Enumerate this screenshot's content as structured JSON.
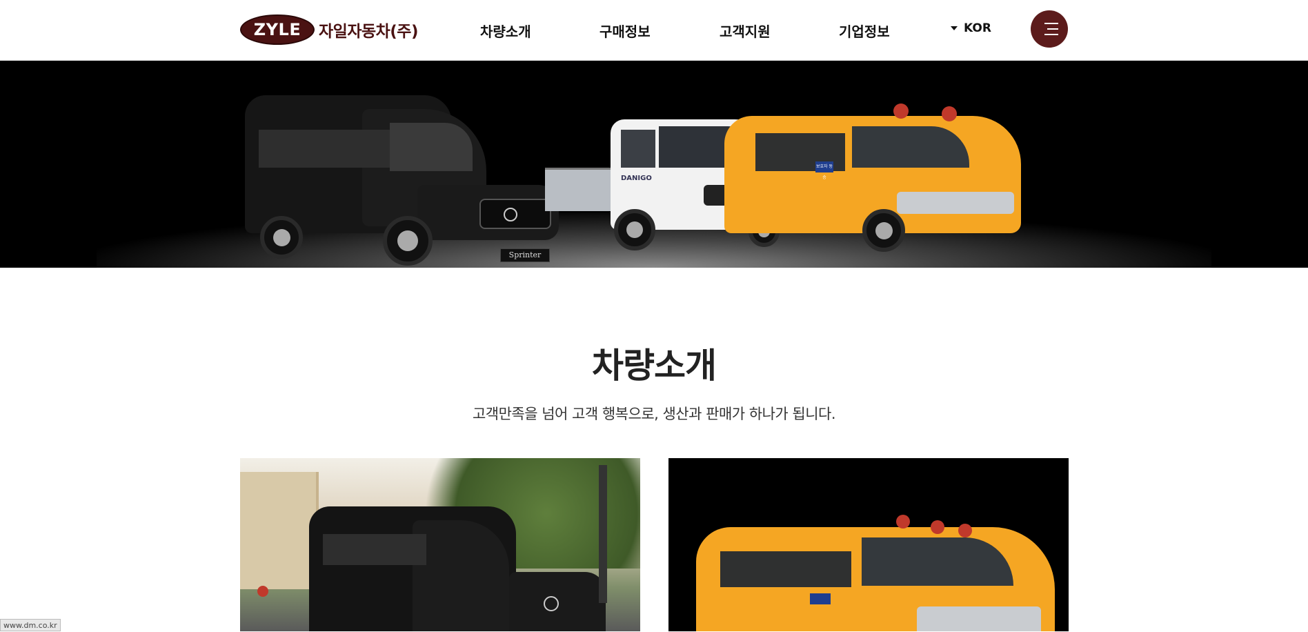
{
  "header": {
    "logo_mark": "ZYLE",
    "logo_text": "자일자동차(주)",
    "nav": [
      "차량소개",
      "구매정보",
      "고객지원",
      "기업정보"
    ],
    "lang": "KOR"
  },
  "hero": {
    "van_badge": "Sprinter",
    "truck_badge": "DANIGO",
    "bus_sign": "보호자 동승"
  },
  "section": {
    "title": "차량소개",
    "subtitle": "고객만족을 넘어 고객 행복으로, 생산과 판매가 하나가 됩니다."
  },
  "status_bar": "www.dm.co.kr",
  "colors": {
    "brand": "#5c1b1b",
    "bus_yellow": "#f5a623",
    "hero_bg": "#000000"
  }
}
